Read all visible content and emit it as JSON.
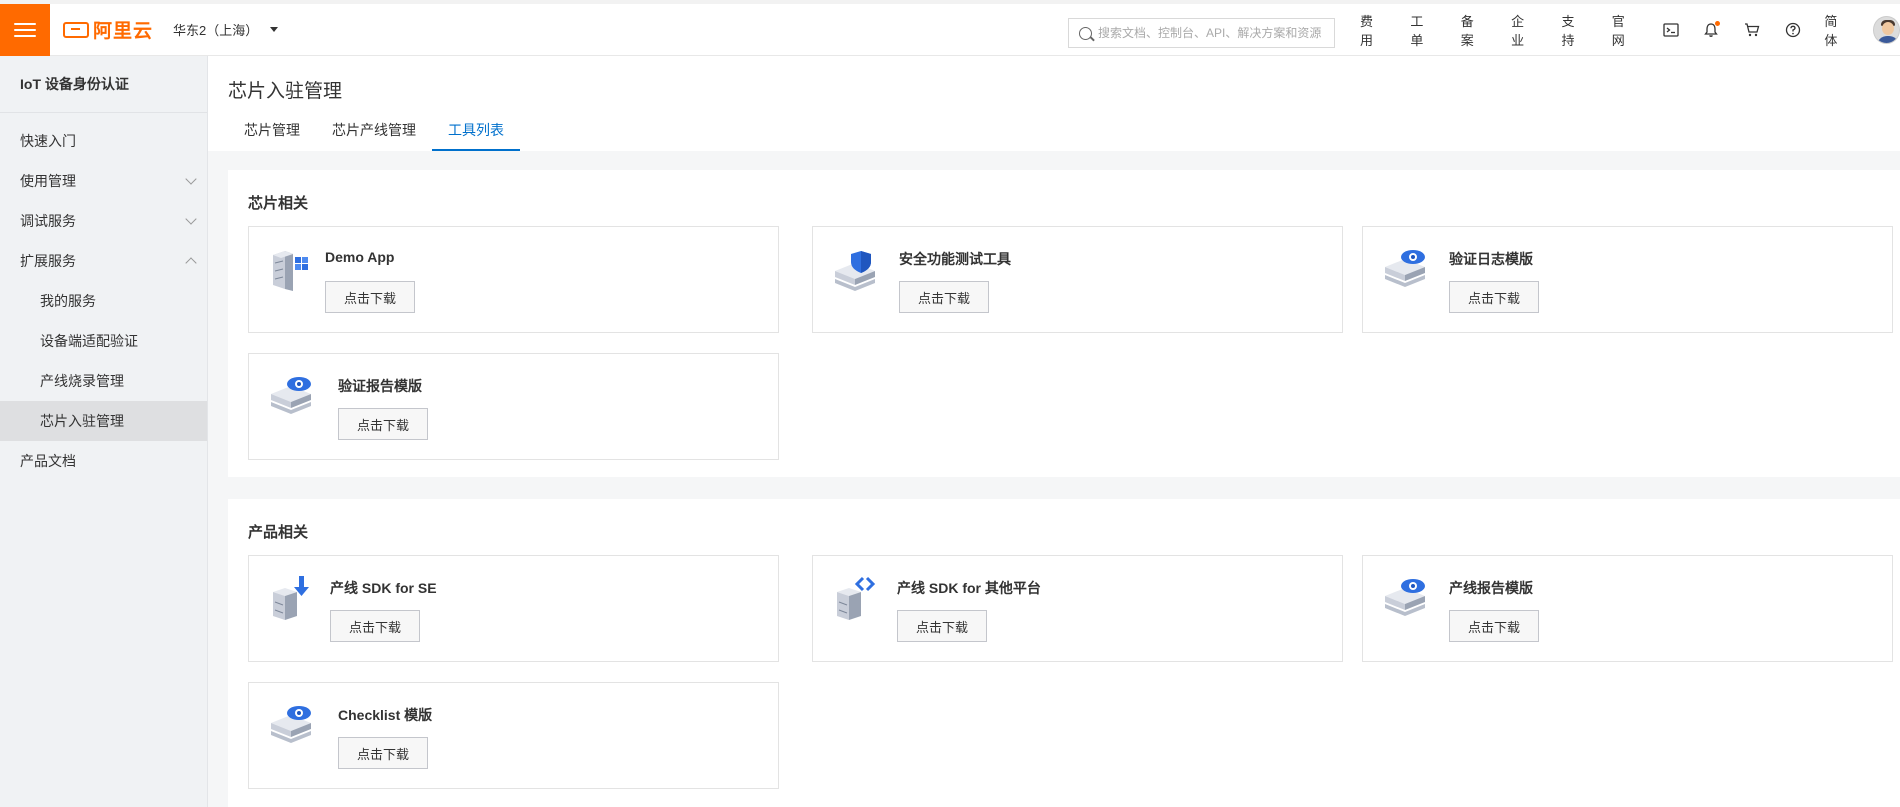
{
  "header": {
    "brand": "阿里云",
    "region": "华东2（上海）",
    "search_placeholder": "搜索文档、控制台、API、解决方案和资源",
    "nav": [
      "费用",
      "工单",
      "备案",
      "企业",
      "支持",
      "官网"
    ],
    "icons": [
      "terminal-icon",
      "bell-icon",
      "cart-icon",
      "help-icon"
    ],
    "language": "简体"
  },
  "sidebar": {
    "title": "IoT 设备身份认证",
    "items": [
      {
        "label": "快速入门"
      },
      {
        "label": "使用管理"
      },
      {
        "label": "调试服务"
      },
      {
        "label": "扩展服务"
      },
      {
        "label": "我的服务"
      },
      {
        "label": "设备端适配验证"
      },
      {
        "label": "产线烧录管理"
      },
      {
        "label": "芯片入驻管理"
      },
      {
        "label": "产品文档"
      }
    ]
  },
  "page": {
    "title": "芯片入驻管理",
    "tabs": [
      "芯片管理",
      "芯片产线管理",
      "工具列表"
    ],
    "active_tab": "工具列表"
  },
  "sections": [
    {
      "title": "芯片相关",
      "cards": [
        {
          "name": "Demo App",
          "button": "点击下载",
          "icon": "server-grid-icon"
        },
        {
          "name": "安全功能测试工具",
          "button": "点击下载",
          "icon": "shield-stack-icon"
        },
        {
          "name": "验证日志模版",
          "button": "点击下载",
          "icon": "eye-stack-icon"
        },
        {
          "name": "验证报告模版",
          "button": "点击下载",
          "icon": "eye-stack-icon"
        }
      ]
    },
    {
      "title": "产品相关",
      "cards": [
        {
          "name": "产线 SDK for SE",
          "button": "点击下载",
          "icon": "download-cube-icon"
        },
        {
          "name": "产线 SDK for 其他平台",
          "button": "点击下载",
          "icon": "code-cube-icon"
        },
        {
          "name": "产线报告模版",
          "button": "点击下载",
          "icon": "eye-stack-icon"
        },
        {
          "name": "Checklist 模版",
          "button": "点击下载",
          "icon": "eye-stack-icon"
        }
      ]
    }
  ],
  "colors": {
    "brand": "#ff6a00",
    "accent": "#0070cc"
  }
}
